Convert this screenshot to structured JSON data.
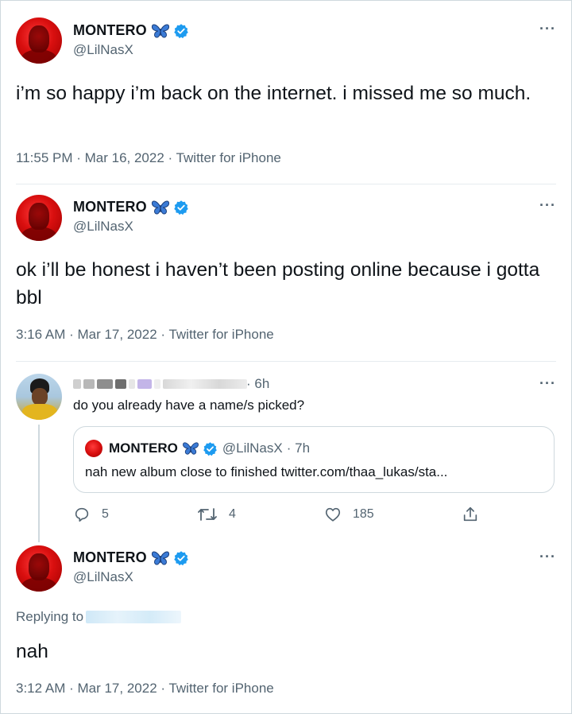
{
  "tweets": [
    {
      "name": "MONTERO",
      "handle": "@LilNasX",
      "text": "i’m so happy i’m back on the internet. i missed me so much.",
      "meta": "11:55 PM · Mar 16, 2022 · Twitter for iPhone"
    },
    {
      "name": "MONTERO",
      "handle": "@LilNasX",
      "text": "ok i’ll be honest i haven’t been posting online because i gotta bbl",
      "meta": "3:16 AM · Mar 17, 2022 · Twitter for iPhone"
    }
  ],
  "reply_tweet": {
    "time": "· 6h",
    "text": "do you already have a name/s picked?",
    "quote": {
      "name": "MONTERO",
      "handle": "@LilNasX",
      "time": "· 7h",
      "text": "nah new album close to finished twitter.com/thaa_lukas/sta..."
    },
    "actions": {
      "replies": "5",
      "retweets": "4",
      "likes": "185"
    }
  },
  "final_tweet": {
    "name": "MONTERO",
    "handle": "@LilNasX",
    "replying_to_label": "Replying to",
    "text": "nah",
    "meta": "3:12 AM · Mar 17, 2022 · Twitter for iPhone"
  },
  "more_label": "···",
  "colors": {
    "verified": "#1d9bf0",
    "butterfly": "#3b7bd6",
    "secondary_text": "#536471",
    "border": "#cfd9de"
  },
  "icons": [
    "verified-badge-icon",
    "butterfly-emoji-icon",
    "more-icon",
    "reply-icon",
    "retweet-icon",
    "like-icon",
    "share-icon"
  ]
}
